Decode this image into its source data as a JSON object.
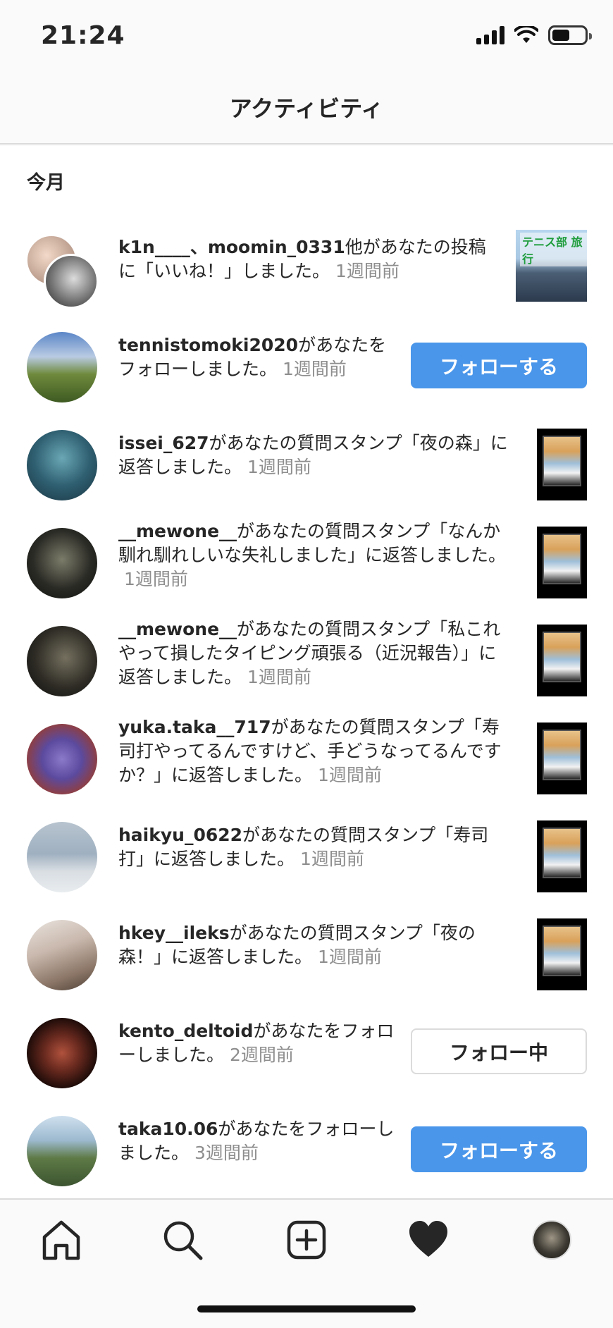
{
  "status_bar": {
    "time": "21:24"
  },
  "header": {
    "title": "アクティビティ"
  },
  "section": {
    "title": "今月"
  },
  "activities": [
    {
      "user": "k1n____、moomin_0331",
      "text": "他があなたの投稿に「いいね！」しました。",
      "time": "1週間前",
      "thumbnail_caption": "テニス部 旅行"
    },
    {
      "user": "tennistomoki2020",
      "text": "があなたをフォローしました。",
      "time": "1週間前",
      "button": "フォローする"
    },
    {
      "user": "issei_627",
      "text": "があなたの質問スタンプ「夜の森」に返答しました。",
      "time": "1週間前"
    },
    {
      "user": "__mewone__",
      "text": "があなたの質問スタンプ「なんか馴れ馴れしいな失礼しました」に返答しました。",
      "time": "1週間前"
    },
    {
      "user": "__mewone__",
      "text": "があなたの質問スタンプ「私これやって損したタイピング頑張る（近況報告）」に返答しました。",
      "time": "1週間前"
    },
    {
      "user": "yuka.taka__717",
      "text": "があなたの質問スタンプ「寿司打やってるんですけど、手どうなってるんですか？」に返答しました。",
      "time": "1週間前"
    },
    {
      "user": "haikyu_0622",
      "text": "があなたの質問スタンプ「寿司打」に返答しました。",
      "time": "1週間前"
    },
    {
      "user": "hkey__ileks",
      "text": "があなたの質問スタンプ「夜の森！」に返答しました。",
      "time": "1週間前"
    },
    {
      "user": "kento_deltoid",
      "text": "があなたをフォローしました。",
      "time": "2週間前",
      "button": "フォロー中"
    },
    {
      "user": "taka10.06",
      "text": "があなたをフォローしました。",
      "time": "3週間前",
      "button": "フォローする"
    }
  ],
  "colors": {
    "accent": "#4a96ea",
    "text": "#262626",
    "secondary_text": "#8e8e8e",
    "divider": "#dbdbdb"
  },
  "tab_bar": {
    "icons": [
      "home-icon",
      "search-icon",
      "new-post-icon",
      "heart-icon",
      "profile-avatar"
    ]
  }
}
